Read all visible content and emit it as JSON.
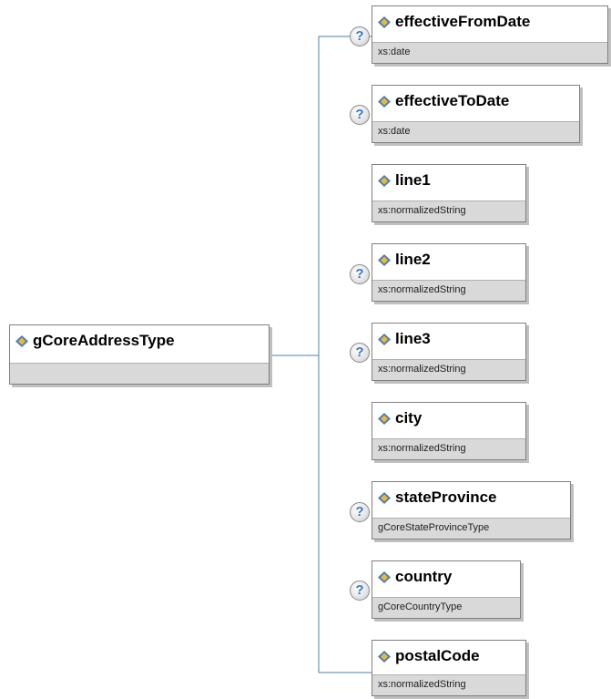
{
  "root": {
    "name": "gCoreAddressType"
  },
  "elements": [
    {
      "name": "effectiveFromDate",
      "type": "xs:date",
      "optional": true
    },
    {
      "name": "effectiveToDate",
      "type": "xs:date",
      "optional": true
    },
    {
      "name": "line1",
      "type": "xs:normalizedString",
      "optional": false
    },
    {
      "name": "line2",
      "type": "xs:normalizedString",
      "optional": true
    },
    {
      "name": "line3",
      "type": "xs:normalizedString",
      "optional": true
    },
    {
      "name": "city",
      "type": "xs:normalizedString",
      "optional": false
    },
    {
      "name": "stateProvince",
      "type": "gCoreStateProvinceType",
      "optional": true
    },
    {
      "name": "country",
      "type": "gCoreCountryType",
      "optional": true
    },
    {
      "name": "postalCode",
      "type": "xs:normalizedString",
      "optional": false
    }
  ],
  "icons": {
    "optional_marker": "?",
    "element_icon": "element-icon",
    "help_icon": "question-icon"
  },
  "colors": {
    "connector": "#4a7fb5",
    "type_band": "#d9d9d9",
    "help_glyph": "#3a78c8"
  }
}
